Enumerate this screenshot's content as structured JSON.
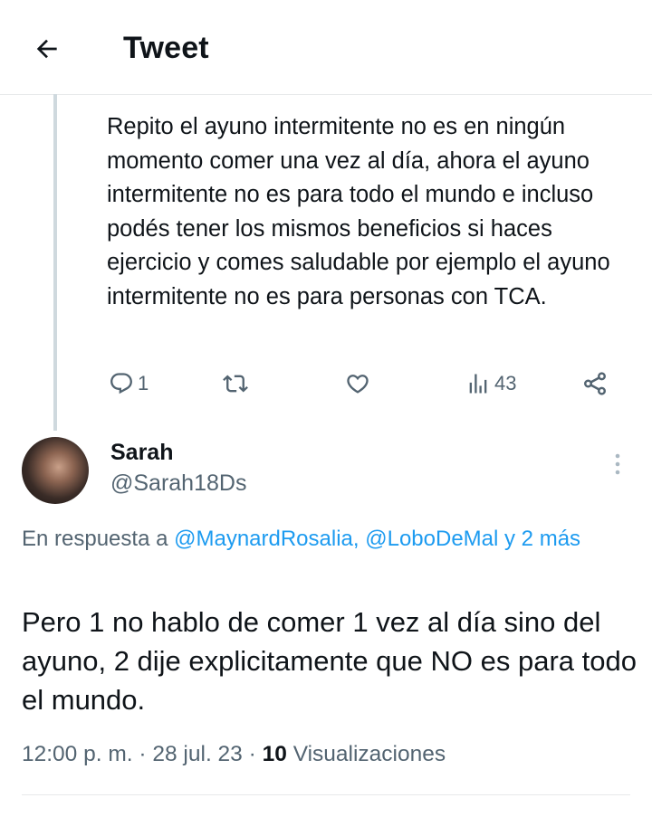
{
  "header": {
    "title": "Tweet",
    "back_icon": "arrow-left-icon"
  },
  "parent_tweet": {
    "text": "Repito el ayuno intermitente no es en ningún momento comer una vez al día, ahora el ayuno intermitente no es para todo el mundo e incluso podés tener los mismos beneficios si haces ejercicio y comes saludable por ejemplo el ayuno intermitente no es para personas con TCA.",
    "replies": "1",
    "retweets": "",
    "likes": "",
    "views": "43",
    "icons": [
      "reply-icon",
      "retweet-icon",
      "heart-icon",
      "views-icon",
      "share-icon"
    ]
  },
  "tweet": {
    "author_name": "Sarah",
    "author_handle": "@Sarah18Ds",
    "reply_prefix": "En respuesta a ",
    "mention_1": "@MaynardRosalia",
    "separator": ", ",
    "mention_2": "@LoboDeMal",
    "mention_3": " y 2 más",
    "text": "Pero 1 no hablo de comer 1 vez al día sino del ayuno, 2 dije explicitamente que NO es para todo el mundo.",
    "time": "12:00 p. m.",
    "dot": "·",
    "date": "28 jul. 23",
    "views_count": "10",
    "views_label": "Visualizaciones"
  },
  "colors": {
    "text": "#0f1419",
    "secondary": "#536471",
    "link": "#1d9bf0",
    "border": "#e7e9ea"
  }
}
